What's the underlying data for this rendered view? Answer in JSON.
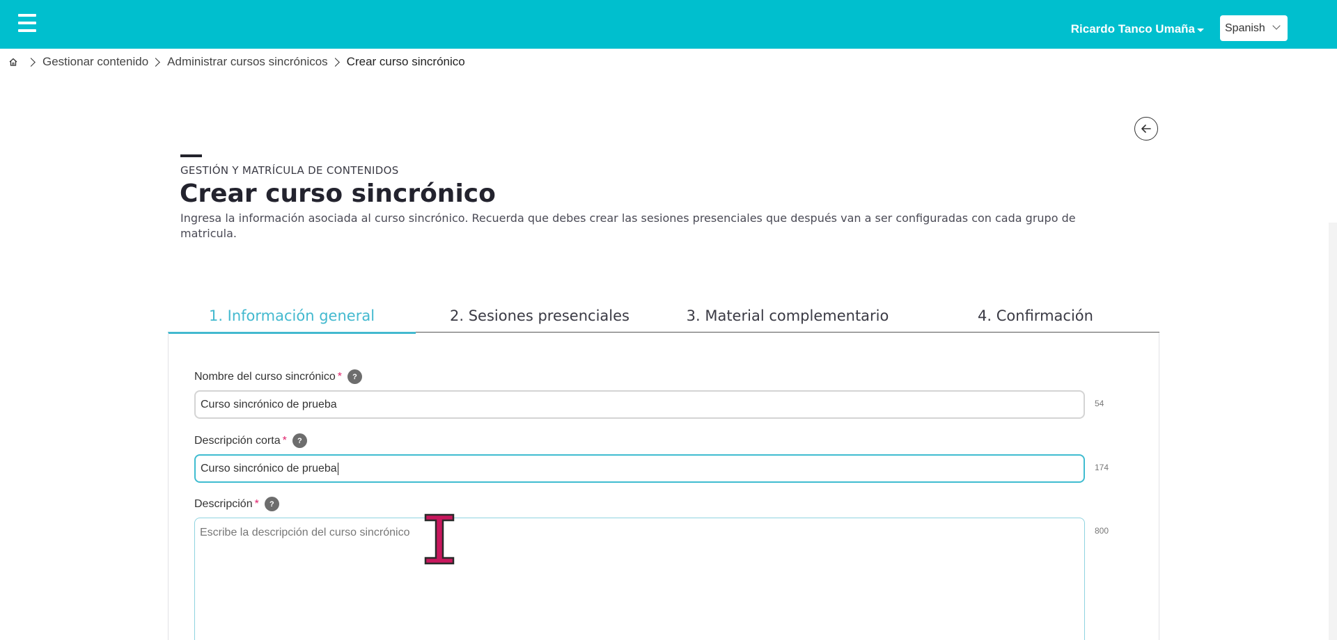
{
  "header": {
    "user_name": "Ricardo Tanco Umaña",
    "language": "Spanish",
    "color": "#00bfce"
  },
  "breadcrumb": {
    "items": [
      "Gestionar contenido",
      "Administrar cursos sincrónicos"
    ],
    "current": "Crear curso sincrónico"
  },
  "page": {
    "section_label": "GESTIÓN Y MATRÍCULA DE CONTENIDOS",
    "title": "Crear curso sincrónico",
    "description": "Ingresa la información asociada al curso sincrónico. Recuerda que debes crear las sesiones presenciales que después van a ser configuradas con cada grupo de matricula."
  },
  "tabs": [
    {
      "label": "1. Información general",
      "active": true
    },
    {
      "label": "2. Sesiones presenciales",
      "active": false
    },
    {
      "label": "3. Material complementario",
      "active": false
    },
    {
      "label": "4. Confirmación",
      "active": false
    }
  ],
  "form": {
    "name": {
      "label": "Nombre del curso sincrónico",
      "required_mark": "*",
      "help": "?",
      "value": "Curso sincrónico de prueba",
      "counter": "54"
    },
    "short_description": {
      "label": "Descripción corta",
      "required_mark": "*",
      "help": "?",
      "value": "Curso sincrónico de prueba",
      "counter": "174"
    },
    "description": {
      "label": "Descripción",
      "required_mark": "*",
      "help": "?",
      "value": "",
      "placeholder": "Escribe la descripción del curso sincrónico",
      "counter": "800"
    }
  },
  "colors": {
    "accent": "#43b9cf",
    "required": "#e0216b",
    "cursor": "#c8175d"
  }
}
